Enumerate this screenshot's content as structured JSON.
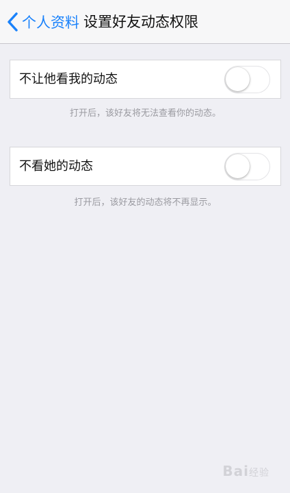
{
  "nav": {
    "back_label": "个人资料",
    "title": "设置好友动态权限"
  },
  "settings": [
    {
      "label": "不让他看我的动态",
      "enabled": false,
      "footer": "打开后，该好友将无法查看你的动态。"
    },
    {
      "label": "不看她的动态",
      "enabled": false,
      "footer": "打开后，该好友的动态将不再显示。"
    }
  ],
  "watermark": {
    "text": "Bai",
    "suffix": "经验"
  },
  "colors": {
    "accent": "#1a82fb",
    "background": "#efeff4",
    "footer_text": "#9a9aa0"
  },
  "icons": {
    "back": "chevron-left-icon"
  }
}
